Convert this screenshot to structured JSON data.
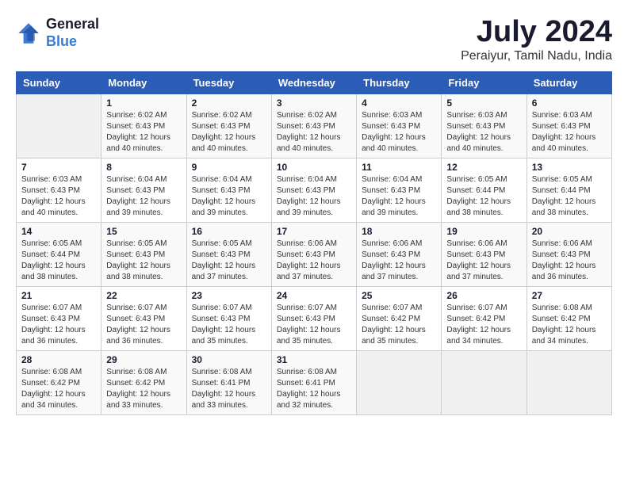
{
  "logo": {
    "line1": "General",
    "line2": "Blue"
  },
  "title": "July 2024",
  "subtitle": "Peraiyur, Tamil Nadu, India",
  "headers": [
    "Sunday",
    "Monday",
    "Tuesday",
    "Wednesday",
    "Thursday",
    "Friday",
    "Saturday"
  ],
  "weeks": [
    [
      {
        "day": "",
        "info": ""
      },
      {
        "day": "1",
        "info": "Sunrise: 6:02 AM\nSunset: 6:43 PM\nDaylight: 12 hours\nand 40 minutes."
      },
      {
        "day": "2",
        "info": "Sunrise: 6:02 AM\nSunset: 6:43 PM\nDaylight: 12 hours\nand 40 minutes."
      },
      {
        "day": "3",
        "info": "Sunrise: 6:02 AM\nSunset: 6:43 PM\nDaylight: 12 hours\nand 40 minutes."
      },
      {
        "day": "4",
        "info": "Sunrise: 6:03 AM\nSunset: 6:43 PM\nDaylight: 12 hours\nand 40 minutes."
      },
      {
        "day": "5",
        "info": "Sunrise: 6:03 AM\nSunset: 6:43 PM\nDaylight: 12 hours\nand 40 minutes."
      },
      {
        "day": "6",
        "info": "Sunrise: 6:03 AM\nSunset: 6:43 PM\nDaylight: 12 hours\nand 40 minutes."
      }
    ],
    [
      {
        "day": "7",
        "info": "Sunrise: 6:03 AM\nSunset: 6:43 PM\nDaylight: 12 hours\nand 40 minutes."
      },
      {
        "day": "8",
        "info": "Sunrise: 6:04 AM\nSunset: 6:43 PM\nDaylight: 12 hours\nand 39 minutes."
      },
      {
        "day": "9",
        "info": "Sunrise: 6:04 AM\nSunset: 6:43 PM\nDaylight: 12 hours\nand 39 minutes."
      },
      {
        "day": "10",
        "info": "Sunrise: 6:04 AM\nSunset: 6:43 PM\nDaylight: 12 hours\nand 39 minutes."
      },
      {
        "day": "11",
        "info": "Sunrise: 6:04 AM\nSunset: 6:43 PM\nDaylight: 12 hours\nand 39 minutes."
      },
      {
        "day": "12",
        "info": "Sunrise: 6:05 AM\nSunset: 6:44 PM\nDaylight: 12 hours\nand 38 minutes."
      },
      {
        "day": "13",
        "info": "Sunrise: 6:05 AM\nSunset: 6:44 PM\nDaylight: 12 hours\nand 38 minutes."
      }
    ],
    [
      {
        "day": "14",
        "info": "Sunrise: 6:05 AM\nSunset: 6:44 PM\nDaylight: 12 hours\nand 38 minutes."
      },
      {
        "day": "15",
        "info": "Sunrise: 6:05 AM\nSunset: 6:43 PM\nDaylight: 12 hours\nand 38 minutes."
      },
      {
        "day": "16",
        "info": "Sunrise: 6:05 AM\nSunset: 6:43 PM\nDaylight: 12 hours\nand 37 minutes."
      },
      {
        "day": "17",
        "info": "Sunrise: 6:06 AM\nSunset: 6:43 PM\nDaylight: 12 hours\nand 37 minutes."
      },
      {
        "day": "18",
        "info": "Sunrise: 6:06 AM\nSunset: 6:43 PM\nDaylight: 12 hours\nand 37 minutes."
      },
      {
        "day": "19",
        "info": "Sunrise: 6:06 AM\nSunset: 6:43 PM\nDaylight: 12 hours\nand 37 minutes."
      },
      {
        "day": "20",
        "info": "Sunrise: 6:06 AM\nSunset: 6:43 PM\nDaylight: 12 hours\nand 36 minutes."
      }
    ],
    [
      {
        "day": "21",
        "info": "Sunrise: 6:07 AM\nSunset: 6:43 PM\nDaylight: 12 hours\nand 36 minutes."
      },
      {
        "day": "22",
        "info": "Sunrise: 6:07 AM\nSunset: 6:43 PM\nDaylight: 12 hours\nand 36 minutes."
      },
      {
        "day": "23",
        "info": "Sunrise: 6:07 AM\nSunset: 6:43 PM\nDaylight: 12 hours\nand 35 minutes."
      },
      {
        "day": "24",
        "info": "Sunrise: 6:07 AM\nSunset: 6:43 PM\nDaylight: 12 hours\nand 35 minutes."
      },
      {
        "day": "25",
        "info": "Sunrise: 6:07 AM\nSunset: 6:42 PM\nDaylight: 12 hours\nand 35 minutes."
      },
      {
        "day": "26",
        "info": "Sunrise: 6:07 AM\nSunset: 6:42 PM\nDaylight: 12 hours\nand 34 minutes."
      },
      {
        "day": "27",
        "info": "Sunrise: 6:08 AM\nSunset: 6:42 PM\nDaylight: 12 hours\nand 34 minutes."
      }
    ],
    [
      {
        "day": "28",
        "info": "Sunrise: 6:08 AM\nSunset: 6:42 PM\nDaylight: 12 hours\nand 34 minutes."
      },
      {
        "day": "29",
        "info": "Sunrise: 6:08 AM\nSunset: 6:42 PM\nDaylight: 12 hours\nand 33 minutes."
      },
      {
        "day": "30",
        "info": "Sunrise: 6:08 AM\nSunset: 6:41 PM\nDaylight: 12 hours\nand 33 minutes."
      },
      {
        "day": "31",
        "info": "Sunrise: 6:08 AM\nSunset: 6:41 PM\nDaylight: 12 hours\nand 32 minutes."
      },
      {
        "day": "",
        "info": ""
      },
      {
        "day": "",
        "info": ""
      },
      {
        "day": "",
        "info": ""
      }
    ]
  ]
}
